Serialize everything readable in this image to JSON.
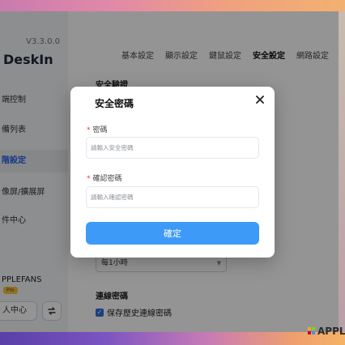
{
  "app": {
    "version": "V3.3.0.0",
    "name": "DeskIn"
  },
  "sidebar": {
    "items": [
      {
        "label": "端控制"
      },
      {
        "label": "備列表"
      },
      {
        "label": "階設定"
      },
      {
        "label": "像屏/擴展屏"
      },
      {
        "label": "件中心"
      }
    ],
    "user_name": "PPLEFANS",
    "badge": "Pro",
    "user_center": "人中心",
    "switch_icon": "swap-icon"
  },
  "tabs": [
    {
      "label": "基本設定"
    },
    {
      "label": "顯示設定"
    },
    {
      "label": "鍵鼠設定"
    },
    {
      "label": "安全設定"
    },
    {
      "label": "網路設定"
    }
  ],
  "content": {
    "security_verify_title": "安全驗證",
    "interval_value": "每1小時",
    "connection_password_title": "連線密碼",
    "save_history_label": "保存歷史連線密碼"
  },
  "modal": {
    "title": "安全密碼",
    "close_icon": "close-icon",
    "password_label": "密碼",
    "password_placeholder": "請輸入安全密碼",
    "confirm_label": "確認密碼",
    "confirm_placeholder": "請輸入確認密碼",
    "submit_label": "確定",
    "required_mark": "*"
  },
  "watermark": "APPL",
  "colors": {
    "accent": "#3d9bf7",
    "required": "#e53935"
  }
}
